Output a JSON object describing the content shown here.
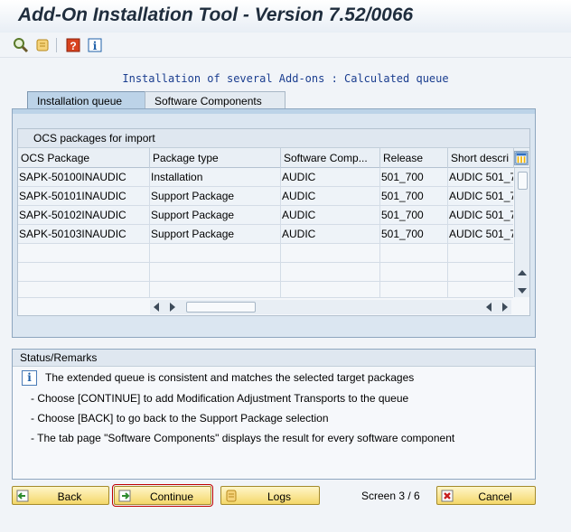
{
  "window": {
    "title": "Add-On Installation Tool - Version 7.52/0066"
  },
  "toolbar": {
    "icons": [
      "magnifier-icon",
      "scroll-icon",
      "help-icon",
      "info-icon"
    ]
  },
  "subtitle": "Installation of several Add-ons : Calculated queue",
  "tabs": [
    {
      "label": "Installation queue",
      "active": true
    },
    {
      "label": "Software Components",
      "active": false
    }
  ],
  "table": {
    "caption": "OCS packages for import",
    "columns": [
      "OCS Package",
      "Package type",
      "Software Comp...",
      "Release",
      "Short descri"
    ],
    "rows": [
      [
        "SAPK-50100INAUDIC",
        "Installation",
        "AUDIC",
        "501_700",
        "AUDIC 501_7"
      ],
      [
        "SAPK-50101INAUDIC",
        "Support Package",
        "AUDIC",
        "501_700",
        "AUDIC 501_7"
      ],
      [
        "SAPK-50102INAUDIC",
        "Support Package",
        "AUDIC",
        "501_700",
        "AUDIC 501_7"
      ],
      [
        "SAPK-50103INAUDIC",
        "Support Package",
        "AUDIC",
        "501_700",
        "AUDIC 501_7"
      ]
    ]
  },
  "status": {
    "title": "Status/Remarks",
    "lines": [
      "The extended queue is consistent and matches the selected target packages",
      "- Choose [CONTINUE] to add Modification Adjustment Transports to the queue",
      "- Choose [BACK] to go back to the Support Package selection",
      "- The tab page \"Software Components\" displays the result for every software component"
    ]
  },
  "buttons": {
    "back": "Back",
    "continue": "Continue",
    "logs": "Logs",
    "cancel": "Cancel"
  },
  "screen_counter": "Screen 3 / 6",
  "colors": {
    "accent": "#1a3d8f",
    "button": "#f4d76a",
    "tab_active": "#bcd3e8",
    "panel": "#dbe6f1"
  }
}
